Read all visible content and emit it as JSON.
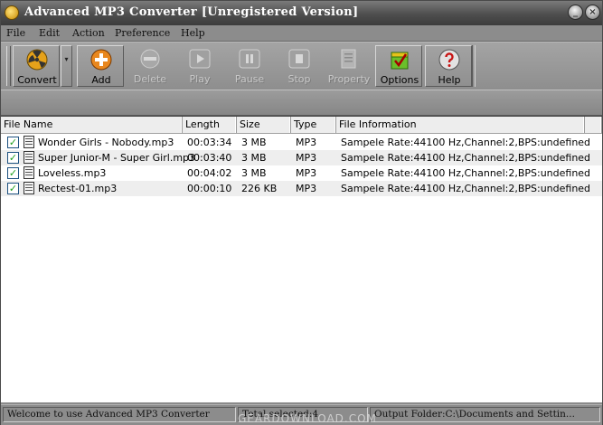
{
  "window": {
    "title": "Advanced MP3 Converter [Unregistered Version]",
    "minimize_glyph": "_",
    "close_glyph": "×"
  },
  "menu": [
    "File",
    "Edit",
    "Action",
    "Preference",
    "Help"
  ],
  "toolbar": {
    "convert": "Convert",
    "add": "Add",
    "delete": "Delete",
    "play": "Play",
    "pause": "Pause",
    "stop": "Stop",
    "property": "Property",
    "options": "Options",
    "help": "Help",
    "dropdown_glyph": "▾"
  },
  "columns": [
    "File Name",
    "Length",
    "Size",
    "Type",
    "File Information"
  ],
  "files": [
    {
      "checked": true,
      "name": "Wonder Girls - Nobody.mp3",
      "length": "00:03:34",
      "size": "3 MB",
      "type": "MP3",
      "info": "Sampele Rate:44100 Hz,Channel:2,BPS:undefined"
    },
    {
      "checked": true,
      "name": "Super Junior-M - Super Girl.mp3",
      "length": "00:03:40",
      "size": "3 MB",
      "type": "MP3",
      "info": "Sampele Rate:44100 Hz,Channel:2,BPS:undefined"
    },
    {
      "checked": true,
      "name": "Loveless.mp3",
      "length": "00:04:02",
      "size": "3 MB",
      "type": "MP3",
      "info": "Sampele Rate:44100 Hz,Channel:2,BPS:undefined"
    },
    {
      "checked": true,
      "name": "Rectest-01.mp3",
      "length": "00:00:10",
      "size": "226 KB",
      "type": "MP3",
      "info": "Sampele Rate:44100 Hz,Channel:2,BPS:undefined"
    }
  ],
  "checkmark": "✓",
  "status": {
    "welcome": "Welcome to use Advanced MP3 Converter",
    "total": "Total selected:4",
    "output": "Output Folder:C:\\Documents and Settin..."
  },
  "watermark": "GEARDOWNLOAD.COM",
  "colors": {
    "add_accent": "#e8871e",
    "options_accent": "#6bbf2a",
    "help_accent": "#cfcfcf",
    "convert_accent": "#e6a21a"
  }
}
